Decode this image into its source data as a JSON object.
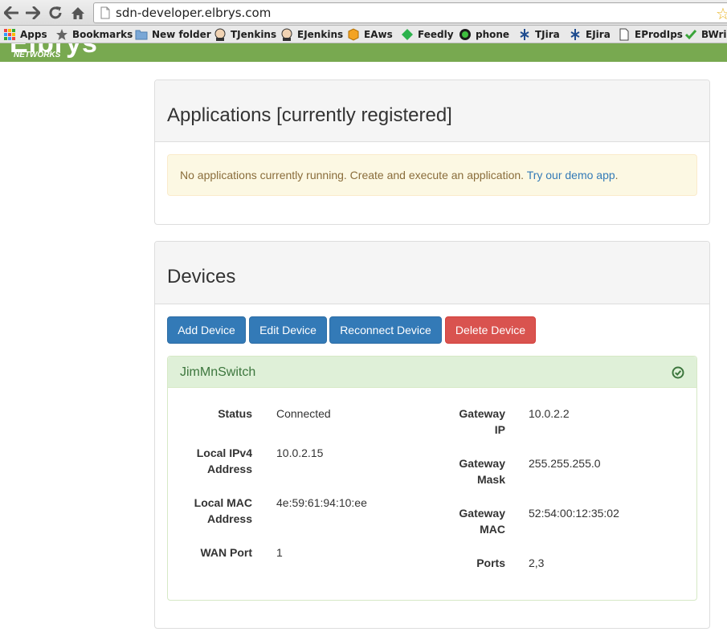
{
  "browser": {
    "url": "sdn-developer.elbrys.com",
    "bookmarks": [
      {
        "label": "Apps",
        "icon": "apps-grid-icon"
      },
      {
        "label": "Bookmarks",
        "icon": "star-icon"
      },
      {
        "label": "New folder",
        "icon": "folder-icon"
      },
      {
        "label": "TJenkins",
        "icon": "jenkins-icon"
      },
      {
        "label": "EJenkins",
        "icon": "jenkins-icon"
      },
      {
        "label": "EAws",
        "icon": "aws-box-icon"
      },
      {
        "label": "Feedly",
        "icon": "feedly-icon"
      },
      {
        "label": "phone",
        "icon": "phone-icon"
      },
      {
        "label": "TJira",
        "icon": "jira-icon"
      },
      {
        "label": "EJira",
        "icon": "jira-icon"
      },
      {
        "label": "EProdIps",
        "icon": "document-icon"
      },
      {
        "label": "BWrik",
        "icon": "checkmark-icon"
      }
    ]
  },
  "site": {
    "logo_text": "Elbrys",
    "logo_subtext": "NETWORKS",
    "brand_color": "#78a950"
  },
  "applications": {
    "title": "Applications [currently registered]",
    "alert_text": "No applications currently running. Create and execute an application. ",
    "alert_link": "Try our demo app",
    "alert_trailing": "."
  },
  "devices": {
    "title": "Devices",
    "buttons": {
      "add": "Add Device",
      "edit": "Edit Device",
      "reconnect": "Reconnect Device",
      "delete": "Delete Device"
    },
    "device": {
      "name": "JimMnSwitch",
      "status_icon": "check-circle-icon",
      "left_fields": [
        {
          "label": "Status",
          "value": "Connected"
        },
        {
          "label": "Local IPv4 Address",
          "value": "10.0.2.15"
        },
        {
          "label": "Local MAC Address",
          "value": "4e:59:61:94:10:ee"
        },
        {
          "label": "WAN Port",
          "value": "1"
        }
      ],
      "right_fields": [
        {
          "label": "Gateway IP",
          "value": "10.0.2.2"
        },
        {
          "label": "Gateway Mask",
          "value": "255.255.255.0"
        },
        {
          "label": "Gateway MAC",
          "value": "52:54:00:12:35:02"
        },
        {
          "label": "Ports",
          "value": "2,3"
        }
      ]
    }
  }
}
